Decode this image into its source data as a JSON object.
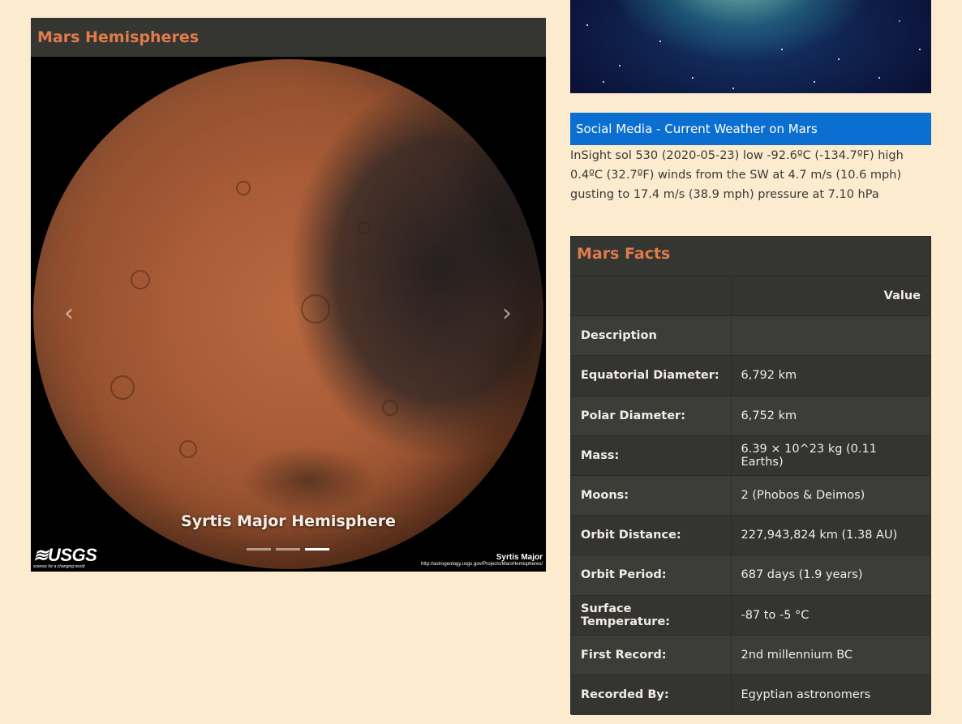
{
  "hemispheres": {
    "title": "Mars Hemispheres",
    "caption": "Syrtis Major Hemisphere",
    "prev_symbol": "‹",
    "next_symbol": "›",
    "indicator_count": 3,
    "active_indicator": 3,
    "logo_text": "≋USGS",
    "logo_tagline": "science for a changing world",
    "credit_name": "Syrtis Major",
    "credit_url": "http://astrogeology.usgs.gov/Projects/MarsHemispheres/"
  },
  "weather": {
    "title": "Social Media - Current Weather on Mars",
    "text": "InSight sol 530 (2020-05-23) low -92.6ºC (-134.7ºF) high 0.4ºC (32.7ºF) winds from the SW at 4.7 m/s (10.6 mph) gusting to 17.4 m/s (38.9 mph) pressure at 7.10 hPa"
  },
  "facts": {
    "title": "Mars Facts",
    "header_value": "Value",
    "rows": [
      {
        "label": "Description",
        "value": ""
      },
      {
        "label": "Equatorial Diameter:",
        "value": "6,792 km"
      },
      {
        "label": "Polar Diameter:",
        "value": "6,752 km"
      },
      {
        "label": "Mass:",
        "value": "6.39 × 10^23 kg (0.11 Earths)"
      },
      {
        "label": "Moons:",
        "value": "2 (Phobos & Deimos)"
      },
      {
        "label": "Orbit Distance:",
        "value": "227,943,824 km (1.38 AU)"
      },
      {
        "label": "Orbit Period:",
        "value": "687 days (1.9 years)"
      },
      {
        "label": "Surface Temperature:",
        "value": "-87 to -5 °C"
      },
      {
        "label": "First Record:",
        "value": "2nd millennium BC"
      },
      {
        "label": "Recorded By:",
        "value": "Egyptian astronomers"
      }
    ]
  },
  "colors": {
    "page_bg": "#fdebcf",
    "card_header_bg": "#353532",
    "card_header_text": "#e07b4b",
    "weather_bar": "#0a6fd0"
  }
}
